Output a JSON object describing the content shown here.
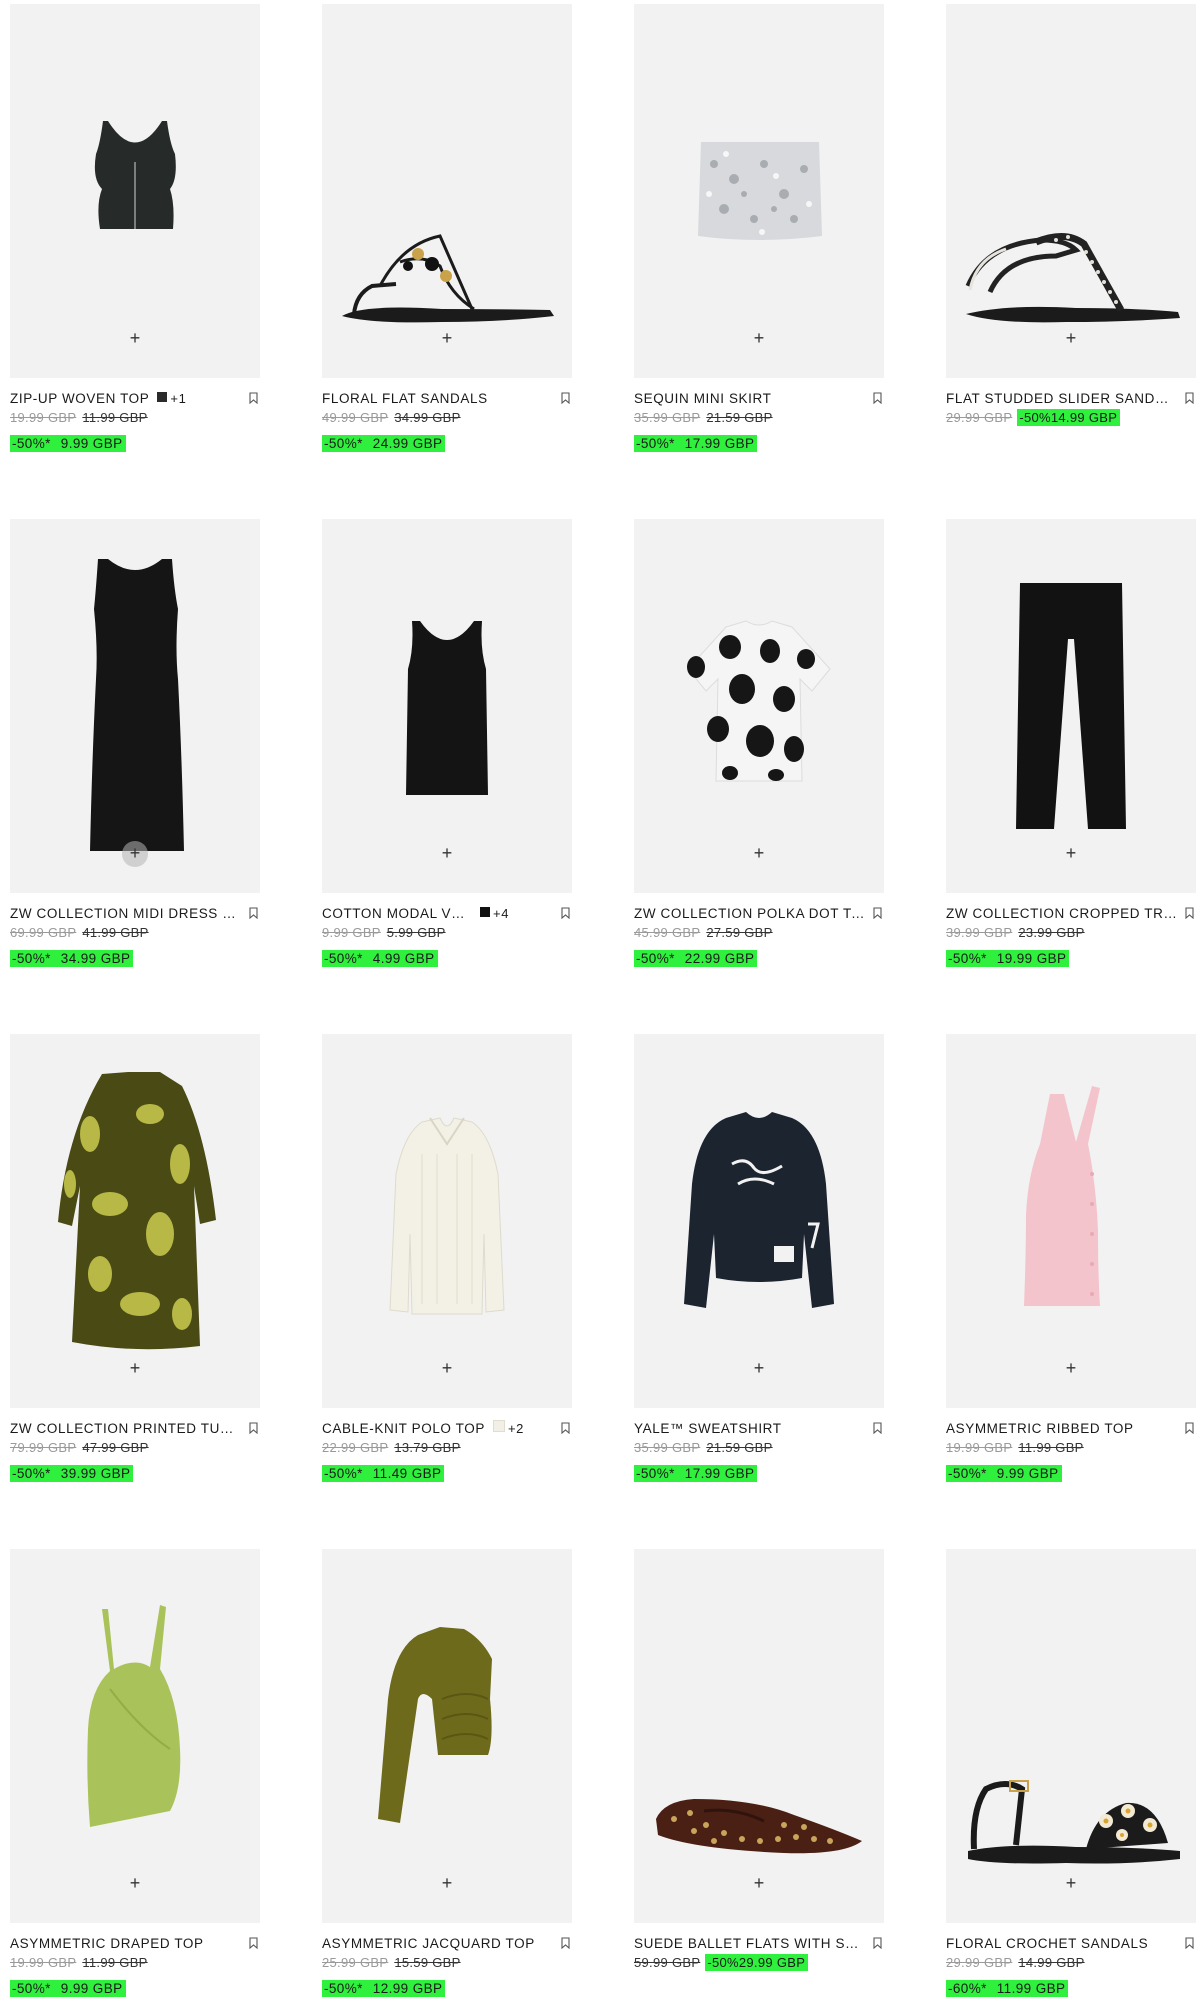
{
  "products": [
    {
      "title": "ZIP-UP WOVEN TOP",
      "swatch": "#2b2b2b",
      "more": "+1",
      "original": "19.99 GBP",
      "previous": "11.99 GBP",
      "discount": "-50%*",
      "price": "9.99 GBP"
    },
    {
      "title": "FLORAL FLAT SANDALS",
      "original": "49.99 GBP",
      "previous": "34.99 GBP",
      "discount": "-50%*",
      "price": "24.99 GBP"
    },
    {
      "title": "SEQUIN MINI SKIRT",
      "original": "35.99 GBP",
      "previous": "21.59 GBP",
      "discount": "-50%*",
      "price": "17.99 GBP"
    },
    {
      "title": "FLAT STUDDED SLIDER SANDALS",
      "original": "29.99 GBP",
      "discount": "-50%",
      "price": "14.99 GBP"
    },
    {
      "title": "ZW COLLECTION MIDI DRESS WITH",
      "original": "69.99 GBP",
      "previous": "41.99 GBP",
      "discount": "-50%*",
      "price": "34.99 GBP"
    },
    {
      "title": "COTTON MODAL VEST TOP",
      "swatch": "#111111",
      "more": "+4",
      "original": "9.99 GBP",
      "previous": "5.99 GBP",
      "discount": "-50%*",
      "price": "4.99 GBP"
    },
    {
      "title": "ZW COLLECTION POLKA DOT T-SHIRT",
      "original": "45.99 GBP",
      "previous": "27.59 GBP",
      "discount": "-50%*",
      "price": "22.99 GBP"
    },
    {
      "title": "ZW COLLECTION CROPPED TROUSERS",
      "original": "39.99 GBP",
      "previous": "23.99 GBP",
      "discount": "-50%*",
      "price": "19.99 GBP"
    },
    {
      "title": "ZW COLLECTION PRINTED TUNIC",
      "original": "79.99 GBP",
      "previous": "47.99 GBP",
      "discount": "-50%*",
      "price": "39.99 GBP"
    },
    {
      "title": "CABLE-KNIT POLO TOP",
      "swatch": "#f1efe6",
      "more": "+2",
      "original": "22.99 GBP",
      "previous": "13.79 GBP",
      "discount": "-50%*",
      "price": "11.49 GBP"
    },
    {
      "title": "YALE™ SWEATSHIRT",
      "original": "35.99 GBP",
      "previous": "21.59 GBP",
      "discount": "-50%*",
      "price": "17.99 GBP"
    },
    {
      "title": "ASYMMETRIC RIBBED TOP",
      "original": "19.99 GBP",
      "previous": "11.99 GBP",
      "discount": "-50%*",
      "price": "9.99 GBP"
    },
    {
      "title": "ASYMMETRIC DRAPED TOP",
      "original": "19.99 GBP",
      "previous": "11.99 GBP",
      "discount": "-50%*",
      "price": "9.99 GBP"
    },
    {
      "title": "ASYMMETRIC JACQUARD TOP",
      "original": "25.99 GBP",
      "previous": "15.59 GBP",
      "discount": "-50%*",
      "price": "12.99 GBP"
    },
    {
      "title": "SUEDE BALLET FLATS WITH STUDS",
      "original": "59.99 GBP",
      "discount": "-50%",
      "price": "29.99 GBP"
    },
    {
      "title": "FLORAL CROCHET SANDALS",
      "original": "29.99 GBP",
      "previous": "14.99 GBP",
      "discount": "-60%*",
      "price": "11.99 GBP"
    }
  ],
  "ui": {
    "add_symbol": "+",
    "accent": "#2ff03d"
  }
}
